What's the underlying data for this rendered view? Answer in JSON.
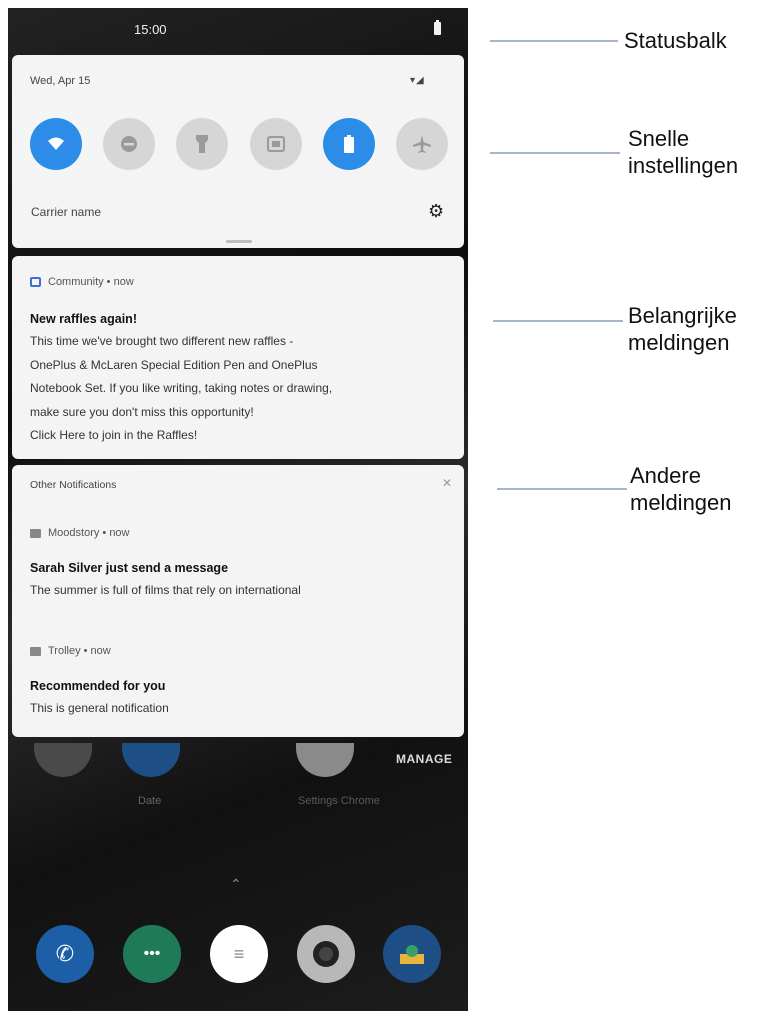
{
  "status_bar": {
    "time": "15:00"
  },
  "quick_settings": {
    "date": "Wed, Apr 15",
    "carrier": "Carrier name",
    "tiles": [
      {
        "icon": "wifi-icon",
        "active": true
      },
      {
        "icon": "do-not-disturb-icon",
        "active": false
      },
      {
        "icon": "flashlight-icon",
        "active": false
      },
      {
        "icon": "screen-rotate-icon",
        "active": false
      },
      {
        "icon": "battery-saver-icon",
        "active": true
      },
      {
        "icon": "airplane-mode-icon",
        "active": false
      }
    ]
  },
  "community_notification": {
    "app": "Community • now",
    "title": "New raffles again!",
    "body_lines": [
      "This time we've brought two different new raffles -",
      "OnePlus & McLaren Special Edition Pen and OnePlus",
      "Notebook Set. If you like writing, taking notes or drawing,",
      "make sure you don't miss this opportunity!",
      "Click Here to join in the Raffles!"
    ]
  },
  "other_notifications": {
    "header": "Other Notifications",
    "items": [
      {
        "app": "Moodstory • now",
        "title": "Sarah Silver just send a message",
        "body": "The summer is full of films that rely on international"
      },
      {
        "app": "Trolley • now",
        "title": "Recommended for you",
        "body": "This is general notification"
      }
    ]
  },
  "home": {
    "manage_label": "MANAGE",
    "label_1": "Date",
    "label_2": "Settings   Chrome"
  },
  "dock": [
    {
      "icon": "phone-icon",
      "color": "#1d5fa6"
    },
    {
      "icon": "messages-icon",
      "color": "#1f7a58"
    },
    {
      "icon": "app-drawer-icon",
      "color": "#ffffff"
    },
    {
      "icon": "camera-icon",
      "color": "#b8b8b8"
    },
    {
      "icon": "gallery-icon",
      "color": "#1d4f86"
    }
  ],
  "annotations": {
    "statusbar": "Statusbalk",
    "quick_settings_1": "Snelle",
    "quick_settings_2": "instellingen",
    "important_1": "Belangrijke",
    "important_2": "meldingen",
    "other_1": "Andere",
    "other_2": "meldingen"
  }
}
